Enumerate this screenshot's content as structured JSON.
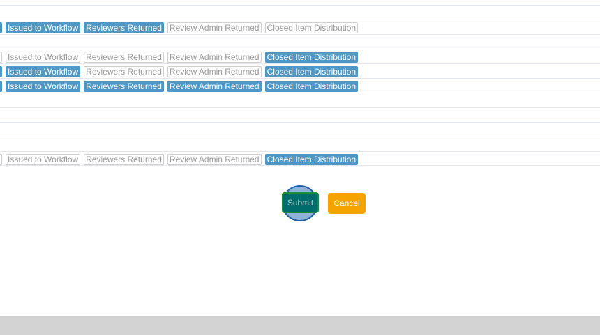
{
  "stages": [
    "Issued to Workflow",
    "Reviewers Returned",
    "Review Admin Returned",
    "Closed Item Distribution"
  ],
  "rows": [
    {
      "visible": false
    },
    {
      "visible": true,
      "active": [
        true,
        true,
        true,
        false,
        false
      ]
    },
    {
      "visible": false
    },
    {
      "visible": true,
      "active": [
        false,
        false,
        false,
        false,
        true
      ]
    },
    {
      "visible": true,
      "active": [
        true,
        true,
        false,
        false,
        true
      ]
    },
    {
      "visible": true,
      "active": [
        true,
        true,
        true,
        true,
        true
      ]
    },
    {
      "visible": false
    },
    {
      "visible": false
    },
    {
      "visible": false
    },
    {
      "visible": false
    },
    {
      "visible": true,
      "active": [
        false,
        false,
        false,
        false,
        true
      ]
    }
  ],
  "row_labels": {
    "r1": [
      "Issued to Workflow",
      "Reviewers Returned",
      "Review Admin Returned",
      "Closed Item Distribution"
    ],
    "r3": [
      "Issued to Workflow",
      "Reviewers Returned",
      "Review Admin Returned",
      "Closed Item Distribution"
    ],
    "r4": [
      "Issued to Workflow",
      "Reviewers Returned",
      "Review Admin Returned",
      "Closed Item Distribution"
    ],
    "r5": [
      "Issued to Workflow",
      "Reviewers Returned",
      "Review Admin Returned",
      "Closed Item Distribution"
    ],
    "r10": [
      "Issued to Workflow",
      "Reviewers Returned",
      "Review Admin Returned",
      "Closed Item Distribution"
    ]
  },
  "actions": {
    "submit_label": "Submit",
    "cancel_label": "Cancel"
  },
  "colors": {
    "active_tag": "#4f97c4",
    "submit": "#006d6d",
    "cancel": "#f5a300",
    "footer": "#d3d3d3"
  }
}
